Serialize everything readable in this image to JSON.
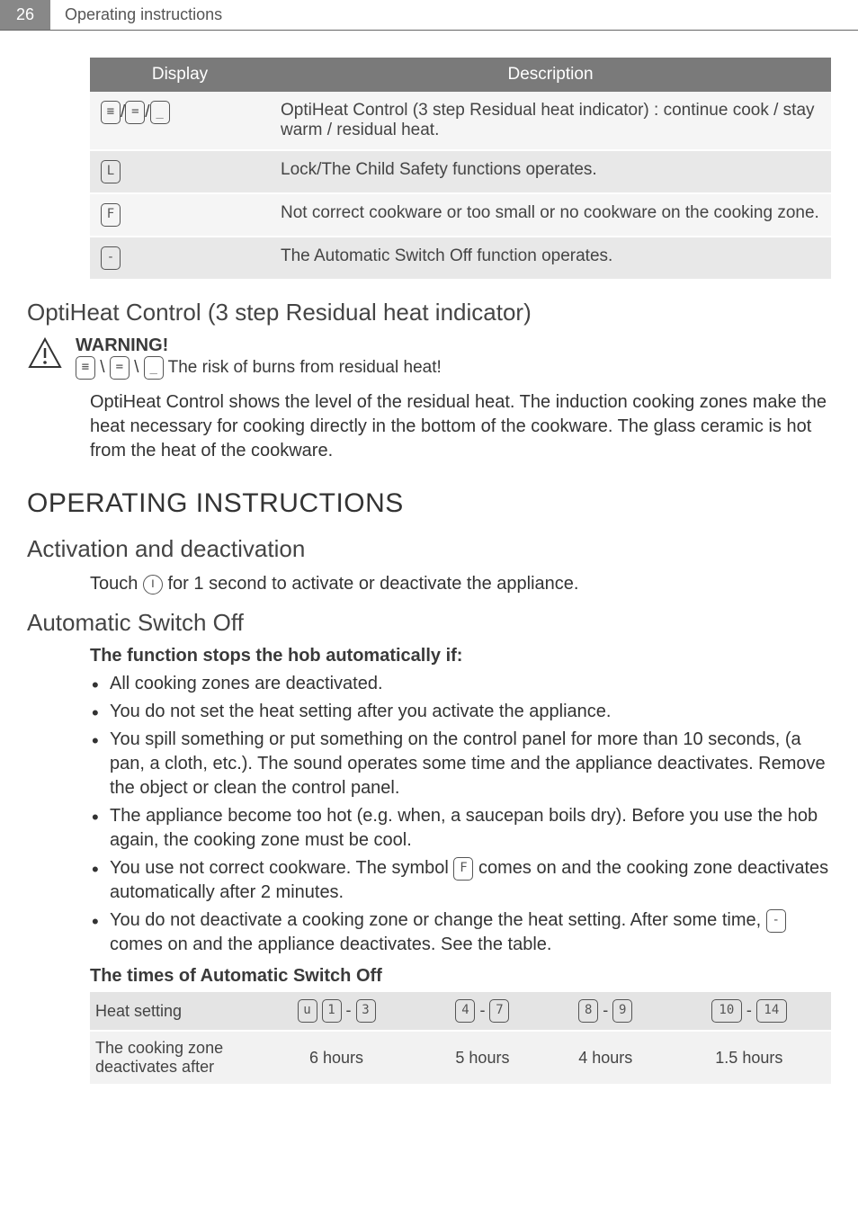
{
  "header": {
    "page_number": "26",
    "breadcrumb": "Operating instructions"
  },
  "display_table": {
    "headers": {
      "display": "Display",
      "description": "Description"
    },
    "rows": [
      {
        "display_glyphs": [
          "≡",
          "=",
          "_"
        ],
        "sep": "/",
        "desc": "OptiHeat Control (3 step Residual heat indicator) : continue cook / stay warm / residual heat."
      },
      {
        "display_glyphs": [
          "L"
        ],
        "sep": "",
        "desc": "Lock/The Child Safety functions operates."
      },
      {
        "display_glyphs": [
          "F"
        ],
        "sep": "",
        "desc": "Not correct cookware or too small or no cookware on the cooking zone."
      },
      {
        "display_glyphs": [
          "-"
        ],
        "sep": "",
        "desc": "The Automatic Switch Off function operates."
      }
    ]
  },
  "optiheat": {
    "title": "OptiHeat Control (3 step Residual heat indicator)",
    "warning_label": "WARNING!",
    "warning_glyphs": [
      "≡",
      "=",
      "_"
    ],
    "warning_text": " The risk of burns from residual heat!",
    "body": "OptiHeat Control shows the level of the residual heat. The induction cooking zones make the heat necessary for cooking directly in the bottom of the cookware. The glass ceramic is hot from the heat of the cookware."
  },
  "main_heading": "OPERATING INSTRUCTIONS",
  "activation": {
    "title": "Activation and deactivation",
    "text_before": "Touch ",
    "text_after": " for 1 second to activate or deactivate the appliance."
  },
  "auto_off": {
    "title": "Automatic Switch Off",
    "intro": "The function stops the hob automatically if:",
    "bullets": [
      {
        "text": "All cooking zones are deactivated."
      },
      {
        "text": "You do not set the heat setting after you activate the appliance."
      },
      {
        "text": "You spill something or put something on the control panel for more than 10 seconds, (a pan, a cloth, etc.). The sound operates some time and the appliance deactivates. Remove the object or clean the control panel."
      },
      {
        "text": "The appliance become too hot (e.g. when, a saucepan boils dry). Before you use the hob again, the cooking zone must be cool."
      },
      {
        "pre": "You use not correct cookware. The symbol ",
        "glyph": "F",
        "post": " comes on and the cooking zone deactivates automatically after 2 minutes."
      },
      {
        "pre": "You do not deactivate a cooking zone or change the heat setting. After some time, ",
        "glyph": "-",
        "post": " comes on and the appliance deactivates. See the table."
      }
    ],
    "times_label": "The times of Automatic Switch Off",
    "times_table": {
      "row_header": "Heat setting",
      "row_label": "The cooking zone deactivates after",
      "cols": [
        {
          "range_glyphs": [
            "u",
            "1",
            "3"
          ],
          "range_seps": [
            " ",
            " - "
          ],
          "value": "6 hours"
        },
        {
          "range_glyphs": [
            "4",
            "7"
          ],
          "range_seps": [
            " - "
          ],
          "value": "5 hours"
        },
        {
          "range_glyphs": [
            "8",
            "9"
          ],
          "range_seps": [
            " - "
          ],
          "value": "4 hours"
        },
        {
          "range_glyphs": [
            "10",
            "14"
          ],
          "range_seps": [
            " - "
          ],
          "value": "1.5 hours"
        }
      ]
    }
  }
}
